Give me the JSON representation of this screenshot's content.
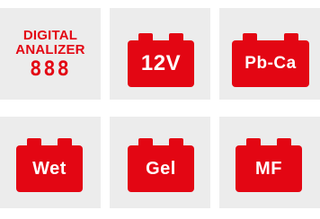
{
  "tiles": {
    "digital_analyzer": {
      "line1": "DIGITAL",
      "line2": "ANALIZER",
      "digits": "888"
    },
    "voltage": {
      "label": "12V",
      "icon": "battery-icon"
    },
    "pb_ca": {
      "label": "Pb-Ca",
      "icon": "battery-icon"
    },
    "wet": {
      "label": "Wet",
      "icon": "battery-icon"
    },
    "gel": {
      "label": "Gel",
      "icon": "battery-icon"
    },
    "mf": {
      "label": "MF",
      "icon": "battery-icon"
    }
  },
  "colors": {
    "accent": "#e30613",
    "tile_background": "#ececec",
    "label_text": "#ffffff"
  }
}
